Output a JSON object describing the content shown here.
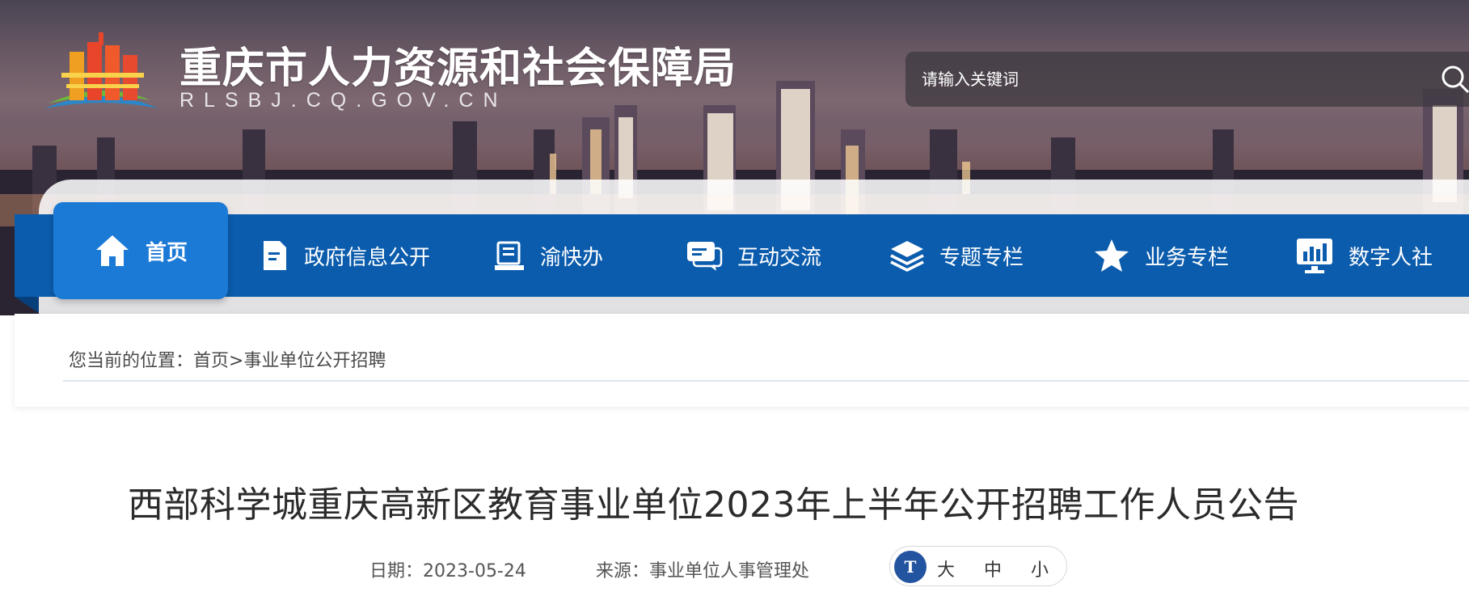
{
  "header": {
    "site_title": "重庆市人力资源和社会保障局",
    "site_domain": "RLSBJ.CQ.GOV.CN",
    "search_placeholder": "请输入关键词"
  },
  "nav": {
    "items": [
      {
        "label": "首页",
        "icon": "home-icon"
      },
      {
        "label": "政府信息公开",
        "icon": "document-icon"
      },
      {
        "label": "渝快办",
        "icon": "service-icon"
      },
      {
        "label": "互动交流",
        "icon": "chat-icon"
      },
      {
        "label": "专题专栏",
        "icon": "layers-icon"
      },
      {
        "label": "业务专栏",
        "icon": "star-icon"
      },
      {
        "label": "数字人社",
        "icon": "monitor-chart-icon"
      }
    ]
  },
  "breadcrumb": {
    "prefix": "您当前的位置：",
    "home": "首页",
    "separator": ">",
    "current": "事业单位公开招聘"
  },
  "article": {
    "title": "西部科学城重庆高新区教育事业单位2023年上半年公开招聘工作人员公告",
    "date_label": "日期：",
    "date": "2023-05-24",
    "source_label": "来源：",
    "source": "事业单位人事管理处",
    "font_size": {
      "icon_text": "T",
      "large": "大",
      "medium": "中",
      "small": "小"
    }
  },
  "colors": {
    "nav_bg": "#0b5cad",
    "nav_active": "#1b7ad6",
    "fontsize_badge": "#23549f"
  }
}
